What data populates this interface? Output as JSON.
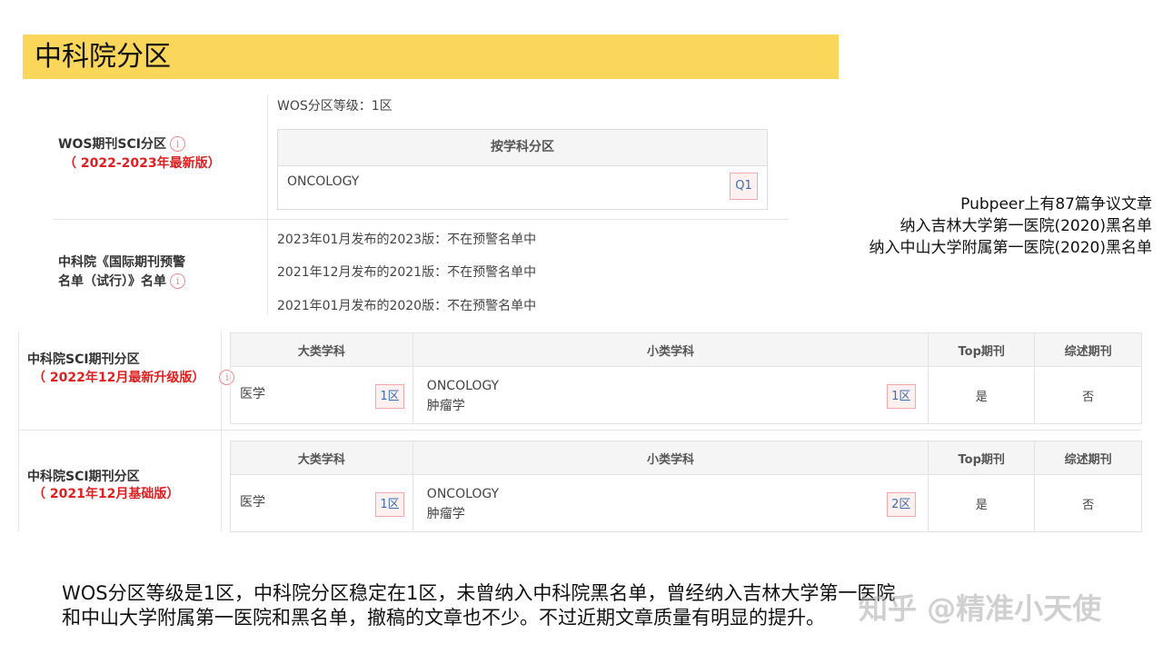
{
  "title": "中科院分区",
  "wos": {
    "label": "WOS期刊SCI分区",
    "version": "（ 2022-2023年最新版）",
    "grade": "WOS分区等级：1区",
    "table_header": "按学科分区",
    "subject": "ONCOLOGY",
    "quartile": "Q1"
  },
  "warning": {
    "label_line1": "中科院《国际期刊预警",
    "label_line2": "名单（试行）》名单",
    "items": [
      "2023年01月发布的2023版：不在预警名单中",
      "2021年12月发布的2021版：不在预警名单中",
      "2021年01月发布的2020版：不在预警名单中"
    ]
  },
  "notes": [
    "Pubpeer上有87篇争议文章",
    "纳入吉林大学第一医院(2020)黑名单",
    "纳入中山大学附属第一医院(2020)黑名单"
  ],
  "cas_2022": {
    "label": "中科院SCI期刊分区",
    "version": "（ 2022年12月最新升级版）",
    "headers": [
      "大类学科",
      "小类学科",
      "Top期刊",
      "综述期刊"
    ],
    "major": "医学",
    "major_zone": "1区",
    "minor_en": "ONCOLOGY",
    "minor_cn": "肿瘤学",
    "minor_zone": "1区",
    "top": "是",
    "review": "否"
  },
  "cas_2021": {
    "label": "中科院SCI期刊分区",
    "version": "（ 2021年12月基础版）",
    "headers": [
      "大类学科",
      "小类学科",
      "Top期刊",
      "综述期刊"
    ],
    "major": "医学",
    "major_zone": "1区",
    "minor_en": "ONCOLOGY",
    "minor_cn": "肿瘤学",
    "minor_zone": "2区",
    "top": "是",
    "review": "否"
  },
  "summary_line1": "WOS分区等级是1区，中科院分区稳定在1区，未曾纳入中科院黑名单，曾经纳入吉林大学第一医院",
  "summary_line2": "和中山大学附属第一医院和黑名单，撤稿的文章也不少。不过近期文章质量有明显的提升。",
  "watermark": "知乎 @精准小天使",
  "colors": {
    "banner": "#fad75a",
    "accent_red": "#e02020",
    "badge_text": "#3a6fb0"
  }
}
